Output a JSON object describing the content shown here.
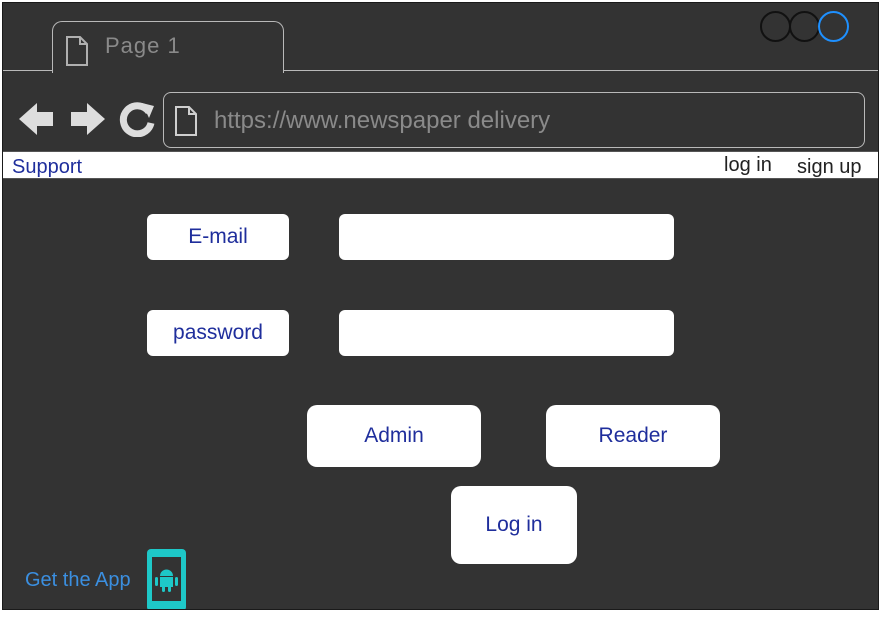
{
  "browser": {
    "tab_label": "Page 1",
    "url": "https://www.newspaper delivery",
    "icons": [
      "page-icon",
      "back-arrow-icon",
      "forward-arrow-icon",
      "reload-icon",
      "window-control-icon"
    ]
  },
  "menubar": {
    "support": "Support",
    "login": "log in",
    "signup": "sign up"
  },
  "form": {
    "email_label": "E-mail",
    "email_value": "",
    "password_label": "password",
    "password_value": "",
    "admin_button": "Admin",
    "reader_button": "Reader",
    "login_button": "Log in"
  },
  "footer": {
    "get_app": "Get the App",
    "icon": "android-phone-icon"
  },
  "colors": {
    "background": "#333333",
    "label_text": "#1f2e9c",
    "link": "#3b8fe0",
    "phone": "#1ec8c8",
    "active_window_button": "#1e90ff"
  }
}
